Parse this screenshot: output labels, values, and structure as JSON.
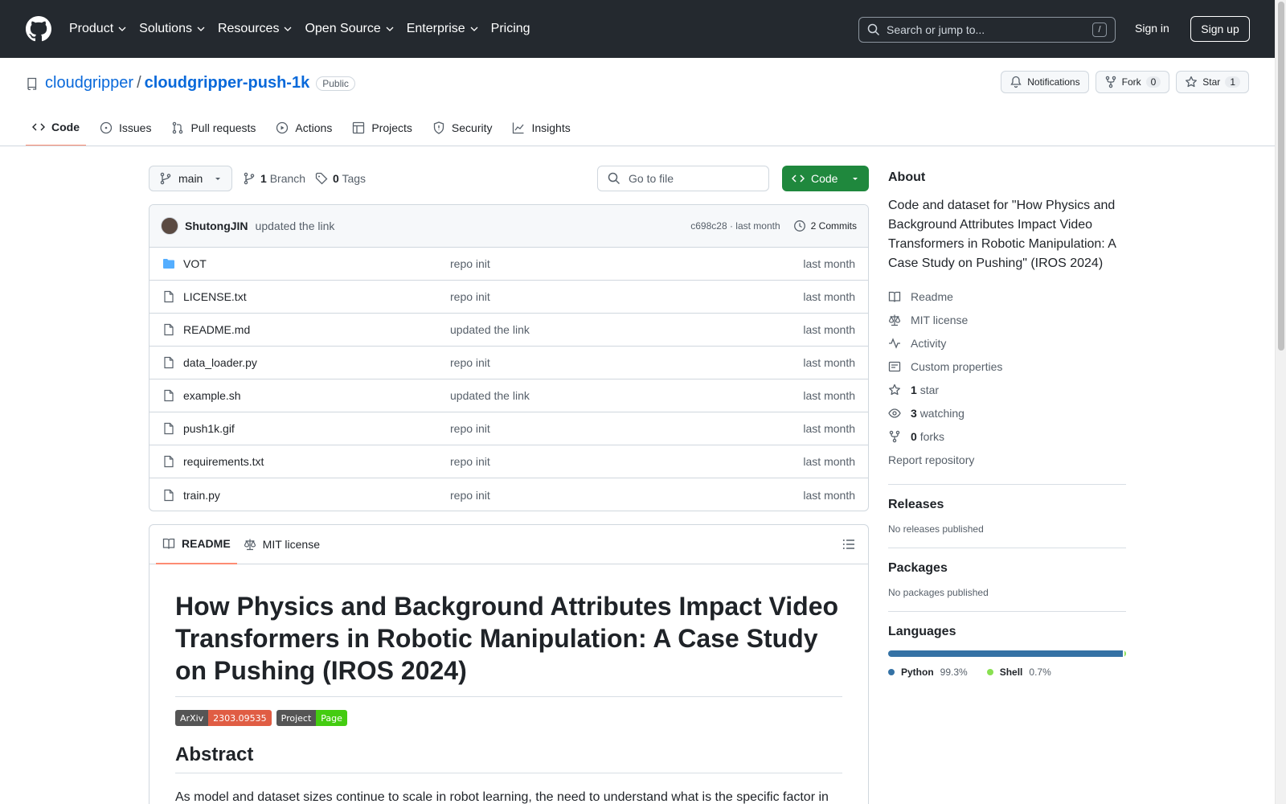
{
  "header": {
    "nav": [
      {
        "label": "Product",
        "dropdown": true
      },
      {
        "label": "Solutions",
        "dropdown": true
      },
      {
        "label": "Resources",
        "dropdown": true
      },
      {
        "label": "Open Source",
        "dropdown": true
      },
      {
        "label": "Enterprise",
        "dropdown": true
      },
      {
        "label": "Pricing",
        "dropdown": false
      }
    ],
    "search_placeholder": "Search or jump to...",
    "search_shortcut": "/",
    "signin": "Sign in",
    "signup": "Sign up"
  },
  "repo": {
    "owner": "cloudgripper",
    "separator": "/",
    "name": "cloudgripper-push-1k",
    "visibility": "Public",
    "notifications": "Notifications",
    "fork": "Fork",
    "fork_count": "0",
    "star": "Star",
    "star_count": "1"
  },
  "tabs": [
    {
      "label": "Code",
      "icon": "code-icon",
      "selected": true
    },
    {
      "label": "Issues",
      "icon": "issue-icon"
    },
    {
      "label": "Pull requests",
      "icon": "pull-request-icon"
    },
    {
      "label": "Actions",
      "icon": "play-icon"
    },
    {
      "label": "Projects",
      "icon": "table-icon"
    },
    {
      "label": "Security",
      "icon": "shield-icon"
    },
    {
      "label": "Insights",
      "icon": "graph-icon"
    }
  ],
  "toolbar": {
    "branch": "main",
    "branch_count": "1",
    "branch_label": "Branch",
    "tag_count": "0",
    "tag_label": "Tags",
    "goto_placeholder": "Go to file",
    "code_button": "Code"
  },
  "commit": {
    "author": "ShutongJIN",
    "message": "updated the link",
    "hash_time": "c698c28 · last month",
    "commits": "2 Commits"
  },
  "files": [
    {
      "name": "VOT",
      "type": "folder",
      "message": "repo init",
      "date": "last month"
    },
    {
      "name": "LICENSE.txt",
      "type": "file",
      "message": "repo init",
      "date": "last month"
    },
    {
      "name": "README.md",
      "type": "file",
      "message": "updated the link",
      "date": "last month"
    },
    {
      "name": "data_loader.py",
      "type": "file",
      "message": "repo init",
      "date": "last month"
    },
    {
      "name": "example.sh",
      "type": "file",
      "message": "updated the link",
      "date": "last month"
    },
    {
      "name": "push1k.gif",
      "type": "file",
      "message": "repo init",
      "date": "last month"
    },
    {
      "name": "requirements.txt",
      "type": "file",
      "message": "repo init",
      "date": "last month"
    },
    {
      "name": "train.py",
      "type": "file",
      "message": "repo init",
      "date": "last month"
    }
  ],
  "readme": {
    "tab_readme": "README",
    "tab_license": "MIT license",
    "title": "How Physics and Background Attributes Impact Video Transformers in Robotic Manipulation: A Case Study on Pushing (IROS 2024)",
    "badges": [
      {
        "left": "ArXiv",
        "right": "2303.09535",
        "color": "#e05d44"
      },
      {
        "left": "Project",
        "right": "Page",
        "color": "#44cc11"
      }
    ],
    "abstract_heading": "Abstract",
    "abstract_text": "As model and dataset sizes continue to scale in robot learning, the need to understand what is the specific factor in"
  },
  "sidebar": {
    "about_heading": "About",
    "description": "Code and dataset for \"How Physics and Background Attributes Impact Video Transformers in Robotic Manipulation: A Case Study on Pushing\" (IROS 2024)",
    "links": [
      {
        "icon": "book-icon",
        "bold": "",
        "label": "Readme"
      },
      {
        "icon": "law-icon",
        "bold": "",
        "label": "MIT license"
      },
      {
        "icon": "pulse-icon",
        "bold": "",
        "label": "Activity"
      },
      {
        "icon": "note-icon",
        "bold": "",
        "label": "Custom properties"
      },
      {
        "icon": "star-icon",
        "bold": "1",
        "label": "star"
      },
      {
        "icon": "eye-icon",
        "bold": "3",
        "label": "watching"
      },
      {
        "icon": "fork-icon",
        "bold": "0",
        "label": "forks"
      }
    ],
    "report": "Report repository",
    "releases_heading": "Releases",
    "releases_text": "No releases published",
    "packages_heading": "Packages",
    "packages_text": "No packages published",
    "languages_heading": "Languages",
    "languages": [
      {
        "name": "Python",
        "percent": "99.3%",
        "fraction": 0.993,
        "color": "#3572A5"
      },
      {
        "name": "Shell",
        "percent": "0.7%",
        "fraction": 0.007,
        "color": "#89e051"
      }
    ]
  }
}
